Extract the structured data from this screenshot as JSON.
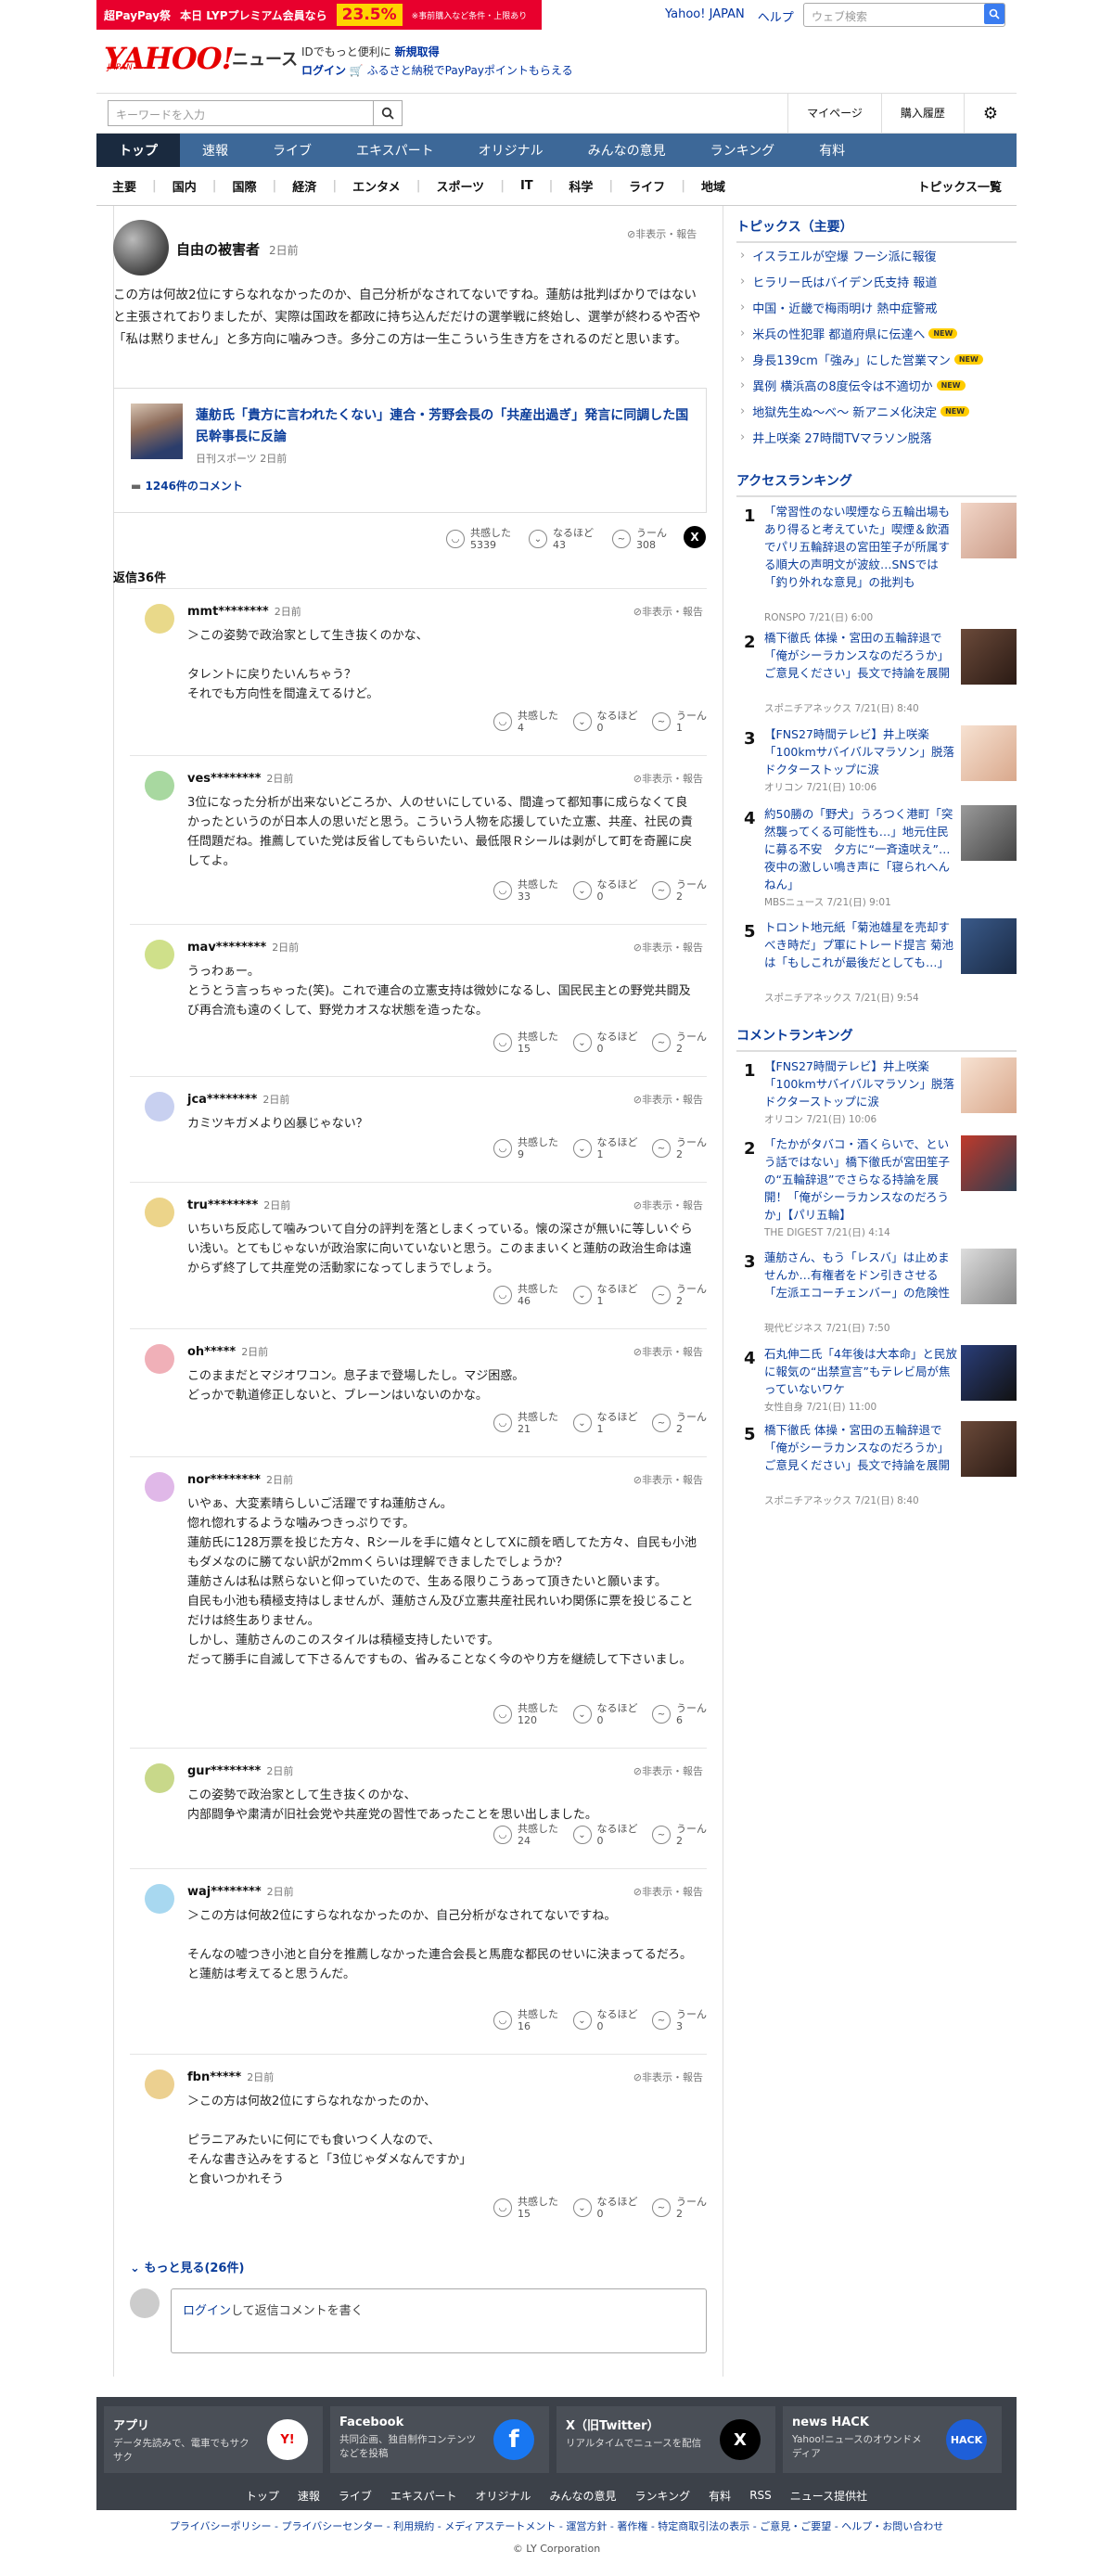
{
  "promo": {
    "fest": "超PayPay祭",
    "today": "本日 LYPプレミアム会員なら",
    "pct": "23.5%",
    "note": "※事前購入など条件・上限あり"
  },
  "header_links": {
    "yahoo": "Yahoo! JAPAN",
    "help": "ヘルプ"
  },
  "web_search_placeholder": "ウェブ検索",
  "logo": {
    "main": "YAHOO!",
    "sub": "JAPAN",
    "news": "ニュース"
  },
  "login_promo": {
    "line1_pre": "IDでもっと便利に",
    "line1_link": "新規取得",
    "line2_link": "ログイン",
    "line2_rest": "ふるさと納税でPayPayポイントもらえる"
  },
  "search": {
    "placeholder": "キーワードを入力",
    "mypage": "マイページ",
    "history": "購入履歴"
  },
  "gnav": [
    "トップ",
    "速報",
    "ライブ",
    "エキスパート",
    "オリジナル",
    "みんなの意見",
    "ランキング",
    "有料"
  ],
  "subnav": [
    "主要",
    "国内",
    "国際",
    "経済",
    "エンタメ",
    "スポーツ",
    "IT",
    "科学",
    "ライフ",
    "地域"
  ],
  "subnav_all": "トピックス一覧",
  "comment": {
    "author": "自由の被害者",
    "time": "2日前",
    "report": "非表示・報告",
    "body": "この方は何故2位にすらなれなかったのか、自己分析がなされてないですね。蓮舫は批判ばかりではないと主張されておりましたが、実際は国政を都政に持ち込んだだけの選挙戦に終始し、選挙が終わるや否や「私は黙りません」と多方向に噛みつき。多分この方は一生こういう生き方をされるのだと思います。",
    "article_title": "蓮舫氏「貴方に言われたくない」連合・芳野会長の「共産出過ぎ」発言に同調した国民幹事長に反論",
    "article_src": "日刊スポーツ 2日前",
    "article_comments": "1246件のコメント",
    "reactions": [
      {
        "label": "共感した",
        "count": "5339"
      },
      {
        "label": "なるほど",
        "count": "43"
      },
      {
        "label": "うーん",
        "count": "308"
      }
    ],
    "x_icon": "X",
    "reply_count": "返信36件"
  },
  "reaction_labels": {
    "agree": "共感した",
    "naruhodo": "なるほど",
    "hmm": "うーん"
  },
  "replies": [
    {
      "user": "mmt********",
      "time": "2日前",
      "text": "＞この姿勢で政治家として生き抜くのかな、\n\nタレントに戻りたいんちゃう？\nそれでも方向性を間違えてるけど。",
      "agree": "4",
      "naruhodo": "0",
      "hmm": "1",
      "color": "#e9d98a"
    },
    {
      "user": "ves********",
      "time": "2日前",
      "text": "3位になった分析が出来ないどころか、人のせいにしている、間違って都知事に成らなくて良かったというのが日本人の思いだと思う。こういう人物を応援していた立憲、共産、社民の責任問題だね。推薦していた党は反省してもらいたい、最低限Ｒシールは剥がして町を奇麗に戻してよ。",
      "agree": "33",
      "naruhodo": "0",
      "hmm": "2",
      "color": "#a8d8a0"
    },
    {
      "user": "mav********",
      "time": "2日前",
      "text": "うっわぁー。\nとうとう言っちゃった(笑)。これで連合の立憲支持は微妙になるし、国民民主との野党共闘及び再合流も遠のくして、野党カオスな状態を造ったな。",
      "agree": "15",
      "naruhodo": "0",
      "hmm": "2",
      "color": "#cfe08a"
    },
    {
      "user": "jca********",
      "time": "2日前",
      "text": "カミツキガメより凶暴じゃない？",
      "agree": "9",
      "naruhodo": "1",
      "hmm": "2",
      "color": "#c8d0f0"
    },
    {
      "user": "tru********",
      "time": "2日前",
      "text": "いちいち反応して噛みついて自分の評判を落としまくっている。懐の深さが無いに等しいぐらい浅い。とてもじゃないが政治家に向いていないと思う。このままいくと蓮舫の政治生命は遠からず終了して共産党の活動家になってしまうでしょう。",
      "agree": "46",
      "naruhodo": "1",
      "hmm": "2",
      "color": "#ecd48a"
    },
    {
      "user": "oh*****",
      "time": "2日前",
      "text": "このままだとマジオワコン。息子まで登場したし。マジ困惑。\nどっかで軌道修正しないと、ブレーンはいないのかな。",
      "agree": "21",
      "naruhodo": "1",
      "hmm": "2",
      "color": "#f0b0b8"
    },
    {
      "user": "nor********",
      "time": "2日前",
      "text": "いやぁ、大変素晴らしいご活躍ですね蓮舫さん。\n惚れ惚れするような噛みつきっぷりです。\n蓮舫氏に128万票を投じた方々、Rシールを手に嬉々としてXに顔を晒してた方々、自民も小池もダメなのに勝てない訳が2mmくらいは理解できましたでしょうか？\n蓮舫さんは私は黙らないと仰っていたので、生ある限りこうあって頂きたいと願います。\n自民も小池も積極支持はしませんが、蓮舫さん及び立憲共産社民れいわ関係に票を投じることだけは終生ありません。\nしかし、蓮舫さんのこのスタイルは積極支持したいです。\nだって勝手に自滅して下さるんですもの、省みることなく今のやり方を継続して下さいまし。",
      "agree": "120",
      "naruhodo": "0",
      "hmm": "6",
      "color": "#e0b8e8"
    },
    {
      "user": "gur********",
      "time": "2日前",
      "text": "この姿勢で政治家として生き抜くのかな、\n内部闘争や粛清が旧社会党や共産党の習性であったことを思い出しました。",
      "agree": "24",
      "naruhodo": "0",
      "hmm": "2",
      "color": "#c8d88a"
    },
    {
      "user": "waj********",
      "time": "2日前",
      "text": "＞この方は何故2位にすらなれなかったのか、自己分析がなされてないですね。\n\nそんなの嘘つき小池と自分を推薦しなかった連合会長と馬鹿な都民のせいに決まってるだろ。\nと蓮舫は考えてると思うんだ。",
      "agree": "16",
      "naruhodo": "0",
      "hmm": "3",
      "color": "#a8d8f0"
    },
    {
      "user": "fbn*****",
      "time": "2日前",
      "text": "＞この方は何故2位にすらなれなかったのか、\n\nピラニアみたいに何にでも食いつく人なので、\nそんな書き込みをすると「3位じゃダメなんですか」\nと食いつかれそう",
      "agree": "15",
      "naruhodo": "0",
      "hmm": "2",
      "color": "#ecd090"
    }
  ],
  "more": "もっと見る(26件)",
  "post": {
    "link": "ログイン",
    "rest": "して返信コメントを書く"
  },
  "topics": {
    "header": "トピックス（主要）",
    "items": [
      {
        "text": "イスラエルが空爆 フーシ派に報復",
        "new": ""
      },
      {
        "text": "ヒラリー氏はバイデン氏支持 報道",
        "new": ""
      },
      {
        "text": "中国・近畿で梅雨明け 熱中症警戒",
        "new": ""
      },
      {
        "text": "米兵の性犯罪 都道府県に伝達へ",
        "new": "NEW"
      },
      {
        "text": "身長139cm「強み」にした営業マン",
        "new": "NEW"
      },
      {
        "text": "異例 横浜高の8度伝令は不適切か",
        "new": "NEW"
      },
      {
        "text": "地獄先生ぬ～べ～ 新アニメ化決定",
        "new": "NEW"
      },
      {
        "text": "井上咲楽 27時間TVマラソン脱落",
        "new": ""
      }
    ]
  },
  "access": {
    "header": "アクセスランキング",
    "items": [
      {
        "no": "1",
        "title": "「常習性のない喫煙なら五輪出場もあり得ると考えていた」喫煙＆飲酒でパリ五輪辞退の宮田笙子が所属する順大の声明文が波紋…SNSでは「釣り外れな意見」の批判も",
        "src": "RONSPO 7/21(日) 6:00"
      },
      {
        "no": "2",
        "title": "橋下徹氏 体操・宮田の五輪辞退で「俺がシーラカンスなのだろうか」ご意見ください」長文で持論を展開",
        "src": "スポニチアネックス 7/21(日) 8:40"
      },
      {
        "no": "3",
        "title": "【FNS27時間テレビ】井上咲楽「100kmサバイバルマラソン」脱落　ドクターストップに涙",
        "src": "オリコン 7/21(日) 10:06"
      },
      {
        "no": "4",
        "title": "約50勝の「野犬」うろつく港町「突然襲ってくる可能性も…」地元住民に募る不安　夕方に“一斉遠吠え”…夜中の激しい鳴き声に「寝られへんねん」",
        "src": "MBSニュース 7/21(日) 9:01"
      },
      {
        "no": "5",
        "title": "トロント地元紙「菊池雄星を売却すべき時だ」プ軍にトレード提言 菊池は「もしこれが最後だとしても…」",
        "src": "スポニチアネックス 7/21(日) 9:54"
      }
    ]
  },
  "comment_rank": {
    "header": "コメントランキング",
    "items": [
      {
        "no": "1",
        "title": "【FNS27時間テレビ】井上咲楽「100kmサバイバルマラソン」脱落　ドクターストップに涙",
        "src": "オリコン 7/21(日) 10:06"
      },
      {
        "no": "2",
        "title": "「たかがタバコ・酒くらいで、という話ではない」橋下徹氏が宮田笙子の“五輪辞退”でさらなる持論を展開！「俺がシーラカンスなのだろうか」【パリ五輪】",
        "src": "THE DIGEST 7/21(日) 4:14"
      },
      {
        "no": "3",
        "title": "蓮舫さん、もう「レスバ」は止めませんか…有権者をドン引きさせる「左派エコーチェンバー」の危険性",
        "src": "現代ビジネス 7/21(日) 7:50"
      },
      {
        "no": "4",
        "title": "石丸伸二氏「4年後は大本命」と民放に報気の“出禁宣言”もテレビ局が焦っていないワケ",
        "src": "女性自身 7/21(日) 11:00"
      },
      {
        "no": "5",
        "title": "橋下徹氏 体操・宮田の五輪辞退で「俺がシーラカンスなのだろうか」ご意見ください」長文で持論を展開",
        "src": "スポニチアネックス 7/21(日) 8:40"
      }
    ]
  },
  "footer_cards": [
    {
      "title": "アプリ",
      "desc": "データ先読みで、電車でもサクサク",
      "icon": "Y!"
    },
    {
      "title": "Facebook",
      "desc": "共同企画、独自制作コンテンツなどを投稿",
      "icon": "f"
    },
    {
      "title": "X（旧Twitter）",
      "desc": "リアルタイムでニュースを配信",
      "icon": "X"
    },
    {
      "title": "news HACK",
      "desc": "Yahoo!ニュースのオウンドメディア",
      "icon": "HACK"
    }
  ],
  "footer_nav": [
    "トップ",
    "速報",
    "ライブ",
    "エキスパート",
    "オリジナル",
    "みんなの意見",
    "ランキング",
    "有料",
    "RSS",
    "ニュース提供社"
  ],
  "legal": "プライバシーポリシー - プライバシーセンター - 利用規約 - メディアステートメント - 運営方針 - 著作権 - 特定商取引法の表示 - ご意見・ご要望 - ヘルプ・お問い合わせ",
  "copyright": "© LY Corporation"
}
